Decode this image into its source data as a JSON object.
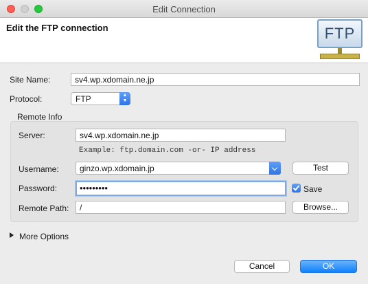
{
  "window": {
    "title": "Edit Connection"
  },
  "header": {
    "title": "Edit the FTP connection",
    "logo_text": "FTP"
  },
  "form": {
    "site_name_label": "Site Name:",
    "site_name_value": "sv4.wp.xdomain.ne.jp",
    "protocol_label": "Protocol:",
    "protocol_value": "FTP"
  },
  "remote_info": {
    "group_label": "Remote Info",
    "server_label": "Server:",
    "server_value": "sv4.wp.xdomain.ne.jp",
    "server_hint": "Example: ftp.domain.com -or- IP address",
    "username_label": "Username:",
    "username_value": "ginzo.wp.xdomain.jp",
    "test_button": "Test",
    "password_label": "Password:",
    "password_value": "•••••••••",
    "save_label": "Save",
    "save_checked": true,
    "remote_path_label": "Remote Path:",
    "remote_path_value": "/",
    "browse_button": "Browse..."
  },
  "more_options": {
    "label": "More Options"
  },
  "footer": {
    "cancel_button": "Cancel",
    "ok_button": "OK"
  },
  "colors": {
    "accent": "#2f73e6",
    "primary_button": "#0d80fe",
    "close": "#fe5f57",
    "maximize": "#28c840"
  }
}
